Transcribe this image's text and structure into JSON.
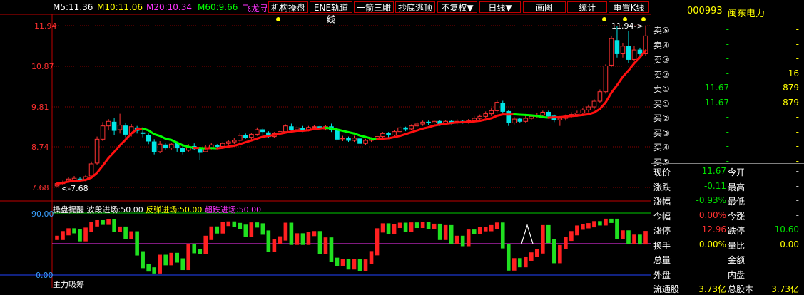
{
  "ma_bar": {
    "m5": "M5:11.36",
    "m10": "M10:11.06",
    "m20": "M20:10.34",
    "m60": "M60:9.66",
    "feilong": "飞龙寻"
  },
  "toolbar": {
    "buttons": [
      "机构操盘",
      "ENE轨道线",
      "一箭三雕",
      "抄底逃顶",
      "不复权▼",
      "日线▼",
      "画图",
      "统计",
      "重置K线"
    ]
  },
  "price_axis": {
    "labels": [
      "11.94",
      "10.87",
      "9.81",
      "8.74",
      "7.68"
    ]
  },
  "annotations": {
    "high_marker": "11.94->",
    "low_marker": "<-7.68"
  },
  "indicator": {
    "title": "操盘提醒",
    "label1": "波段进场:50.00",
    "label2": "反弹进场:50.00",
    "label3": "超跌进场:50.00",
    "axis_top": "90.00",
    "axis_bottom": "0.00",
    "next_title": "主力吸筹"
  },
  "quote": {
    "code": "000993",
    "name": "闽东电力",
    "sell": [
      {
        "label": "卖⑤",
        "price": "-",
        "vol": "-"
      },
      {
        "label": "卖④",
        "price": "-",
        "vol": "-"
      },
      {
        "label": "卖③",
        "price": "-",
        "vol": "-"
      },
      {
        "label": "卖②",
        "price": "-",
        "vol": "16"
      },
      {
        "label": "卖①",
        "price": "11.67",
        "vol": "879"
      }
    ],
    "buy": [
      {
        "label": "买①",
        "price": "11.67",
        "vol": "879"
      },
      {
        "label": "买②",
        "price": "-",
        "vol": "-"
      },
      {
        "label": "买③",
        "price": "-",
        "vol": "-"
      },
      {
        "label": "买④",
        "price": "-",
        "vol": "-"
      },
      {
        "label": "买⑤",
        "price": "-",
        "vol": "-"
      }
    ],
    "stats": [
      {
        "l1": "现价",
        "v1": "11.67",
        "c1": "#00e000",
        "l2": "今开",
        "v2": "-",
        "c2": "#c0c0c0"
      },
      {
        "l1": "涨跌",
        "v1": "-0.11",
        "c1": "#00e000",
        "l2": "最高",
        "v2": "-",
        "c2": "#c0c0c0"
      },
      {
        "l1": "涨幅",
        "v1": "-0.93%",
        "c1": "#00e000",
        "l2": "最低",
        "v2": "-",
        "c2": "#c0c0c0"
      },
      {
        "l1": "今幅",
        "v1": "0.00%",
        "c1": "#ff3030",
        "l2": "今涨",
        "v2": "-",
        "c2": "#c0c0c0"
      },
      {
        "l1": "涨停",
        "v1": "12.96",
        "c1": "#ff3030",
        "l2": "跌停",
        "v2": "10.60",
        "c2": "#00e000"
      },
      {
        "l1": "换手",
        "v1": "0.00%",
        "c1": "#ffff00",
        "l2": "量比",
        "v2": "0.00",
        "c2": "#ffff00"
      },
      {
        "l1": "总量",
        "v1": "-",
        "c1": "#c0c0c0",
        "l2": "金额",
        "v2": "-",
        "c2": "#c0c0c0"
      },
      {
        "l1": "外盘",
        "v1": "-",
        "c1": "#ff3030",
        "l2": "内盘",
        "v2": "-",
        "c2": "#00e000"
      },
      {
        "l1": "流通股",
        "v1": "3.73亿",
        "c1": "#ffff00",
        "l2": "总股本",
        "v2": "3.73亿",
        "c2": "#ffff00"
      }
    ]
  },
  "colors": {
    "up": "#ff3333",
    "down": "#00e5e5",
    "ma_line": "#ff1010",
    "ma_green": "#00ff00",
    "grid": "#8b0000",
    "bull_bar": "#ff2020",
    "bear_bar": "#20e020"
  },
  "chart_data": {
    "type": "candlestick",
    "ylim": [
      7.68,
      11.94
    ],
    "candles": [
      [
        7.72,
        7.78,
        7.7,
        7.82
      ],
      [
        7.78,
        7.82,
        7.74,
        7.86
      ],
      [
        7.84,
        7.9,
        7.8,
        7.95
      ],
      [
        7.86,
        7.92,
        7.82,
        7.98
      ],
      [
        7.9,
        7.88,
        7.84,
        7.96
      ],
      [
        7.88,
        7.96,
        7.84,
        8.02
      ],
      [
        7.98,
        8.3,
        7.94,
        8.36
      ],
      [
        8.32,
        8.95,
        8.28,
        9.02
      ],
      [
        8.95,
        9.3,
        8.9,
        9.4
      ],
      [
        9.3,
        9.42,
        9.18,
        9.48
      ],
      [
        9.4,
        9.18,
        9.05,
        9.5
      ],
      [
        9.2,
        9.32,
        9.1,
        9.62
      ],
      [
        9.3,
        9.08,
        9.0,
        9.38
      ],
      [
        9.1,
        9.28,
        9.02,
        9.35
      ],
      [
        9.25,
        9.18,
        9.1,
        9.3
      ],
      [
        9.12,
        9.1,
        9.0,
        9.2
      ],
      [
        9.05,
        8.9,
        8.82,
        9.1
      ],
      [
        8.88,
        8.62,
        8.55,
        8.95
      ],
      [
        8.62,
        8.82,
        8.58,
        8.9
      ],
      [
        8.8,
        8.72,
        8.66,
        8.86
      ],
      [
        8.72,
        8.82,
        8.66,
        8.86
      ],
      [
        8.84,
        8.72,
        8.62,
        8.88
      ],
      [
        8.72,
        8.62,
        8.55,
        8.78
      ],
      [
        8.66,
        8.76,
        8.62,
        8.82
      ],
      [
        8.76,
        8.7,
        8.66,
        8.84
      ],
      [
        8.72,
        8.6,
        8.4,
        8.74
      ],
      [
        8.62,
        8.72,
        8.6,
        8.8
      ],
      [
        8.72,
        8.8,
        8.68,
        8.86
      ],
      [
        8.78,
        8.76,
        8.7,
        8.82
      ],
      [
        8.76,
        8.84,
        8.72,
        8.88
      ],
      [
        8.84,
        8.88,
        8.8,
        8.92
      ],
      [
        8.88,
        8.92,
        8.82,
        8.98
      ],
      [
        8.92,
        9.05,
        8.86,
        9.12
      ],
      [
        9.05,
        9.0,
        8.96,
        9.1
      ],
      [
        9.0,
        9.08,
        8.94,
        9.12
      ],
      [
        9.08,
        9.2,
        9.04,
        9.26
      ],
      [
        9.2,
        9.15,
        9.06,
        9.24
      ],
      [
        9.12,
        9.02,
        8.98,
        9.16
      ],
      [
        9.02,
        9.1,
        8.98,
        9.14
      ],
      [
        9.1,
        9.15,
        9.04,
        9.2
      ],
      [
        9.15,
        9.3,
        9.12,
        9.34
      ],
      [
        9.28,
        9.2,
        9.14,
        9.36
      ],
      [
        9.2,
        9.25,
        9.16,
        9.3
      ],
      [
        9.24,
        9.2,
        9.14,
        9.3
      ],
      [
        9.2,
        9.26,
        9.16,
        9.3
      ],
      [
        9.26,
        9.28,
        9.2,
        9.32
      ],
      [
        9.28,
        9.22,
        9.18,
        9.34
      ],
      [
        9.22,
        9.28,
        9.18,
        9.32
      ],
      [
        9.28,
        9.2,
        9.14,
        9.36
      ],
      [
        9.2,
        8.95,
        8.85,
        9.24
      ],
      [
        8.96,
        8.98,
        8.9,
        9.04
      ],
      [
        8.98,
        8.92,
        8.88,
        9.02
      ],
      [
        8.92,
        8.98,
        8.88,
        9.04
      ],
      [
        8.96,
        8.84,
        8.78,
        9.0
      ],
      [
        8.84,
        8.92,
        8.8,
        8.96
      ],
      [
        8.92,
        8.96,
        8.88,
        9.0
      ],
      [
        8.96,
        9.02,
        8.92,
        9.08
      ],
      [
        9.02,
        9.1,
        8.98,
        9.14
      ],
      [
        9.1,
        9.06,
        9.0,
        9.14
      ],
      [
        9.06,
        9.15,
        9.02,
        9.2
      ],
      [
        9.15,
        9.25,
        9.12,
        9.3
      ],
      [
        9.25,
        9.22,
        9.16,
        9.28
      ],
      [
        9.22,
        9.3,
        9.18,
        9.34
      ],
      [
        9.3,
        9.35,
        9.26,
        9.4
      ],
      [
        9.35,
        9.4,
        9.3,
        9.44
      ],
      [
        9.4,
        9.38,
        9.32,
        9.44
      ],
      [
        9.38,
        9.42,
        9.34,
        9.46
      ],
      [
        9.42,
        9.36,
        9.3,
        9.46
      ],
      [
        9.36,
        9.42,
        9.32,
        9.46
      ],
      [
        9.42,
        9.38,
        9.34,
        9.46
      ],
      [
        9.38,
        9.42,
        9.34,
        9.48
      ],
      [
        9.42,
        9.4,
        9.36,
        9.46
      ],
      [
        9.4,
        9.44,
        9.36,
        9.48
      ],
      [
        9.44,
        9.5,
        9.4,
        9.56
      ],
      [
        9.5,
        9.55,
        9.46,
        9.6
      ],
      [
        9.55,
        9.62,
        9.5,
        9.68
      ],
      [
        9.62,
        9.7,
        9.56,
        9.76
      ],
      [
        9.7,
        9.92,
        9.66,
        9.98
      ],
      [
        9.9,
        9.68,
        9.6,
        9.96
      ],
      [
        9.68,
        9.38,
        9.3,
        9.72
      ],
      [
        9.38,
        9.48,
        9.34,
        9.54
      ],
      [
        9.48,
        9.42,
        9.38,
        9.52
      ],
      [
        9.42,
        9.5,
        9.38,
        9.56
      ],
      [
        9.5,
        9.55,
        9.46,
        9.6
      ],
      [
        9.55,
        9.58,
        9.5,
        9.64
      ],
      [
        9.58,
        9.66,
        9.52,
        9.7
      ],
      [
        9.66,
        9.56,
        9.5,
        9.7
      ],
      [
        9.56,
        9.46,
        9.4,
        9.6
      ],
      [
        9.46,
        9.5,
        9.3,
        9.56
      ],
      [
        9.5,
        9.56,
        9.44,
        9.6
      ],
      [
        9.56,
        9.6,
        9.5,
        9.66
      ],
      [
        9.6,
        9.64,
        9.54,
        9.7
      ],
      [
        9.64,
        9.72,
        9.58,
        9.78
      ],
      [
        9.72,
        9.8,
        9.66,
        9.86
      ],
      [
        9.8,
        9.95,
        9.74,
        10.0
      ],
      [
        9.95,
        10.2,
        9.9,
        10.26
      ],
      [
        10.2,
        10.88,
        10.15,
        10.92
      ],
      [
        10.9,
        11.6,
        10.85,
        11.66
      ],
      [
        11.55,
        11.2,
        11.1,
        11.94
      ],
      [
        11.2,
        11.4,
        11.1,
        11.48
      ],
      [
        11.4,
        11.05,
        10.95,
        11.8
      ],
      [
        11.05,
        11.3,
        11.0,
        11.4
      ],
      [
        11.3,
        11.2,
        11.1,
        11.36
      ],
      [
        11.2,
        11.67,
        11.15,
        11.94
      ]
    ]
  }
}
